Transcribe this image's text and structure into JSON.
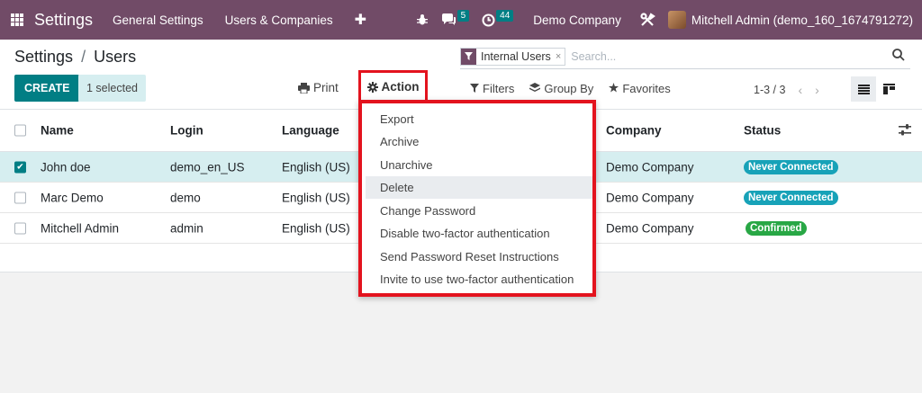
{
  "navbar": {
    "app_title": "Settings",
    "menu": [
      "General Settings",
      "Users & Companies"
    ],
    "plus": "✚",
    "messages_count": "5",
    "activities_count": "44",
    "company": "Demo Company",
    "user": "Mitchell Admin (demo_160_1674791272)",
    "color": "#714B67"
  },
  "breadcrumb": {
    "parent": "Settings",
    "separator": "/",
    "current": "Users"
  },
  "toolbar": {
    "create_label": "CREATE",
    "selected_label": "1 selected",
    "print_label": "Print",
    "action_label": "Action"
  },
  "search": {
    "facet_label": "Internal Users",
    "facet_remove": "×",
    "placeholder": "Search..."
  },
  "filters": {
    "filters_label": "Filters",
    "groupby_label": "Group By",
    "favorites_label": "Favorites"
  },
  "pager": {
    "value": "1-3 / 3",
    "prev": "‹",
    "next": "›"
  },
  "table": {
    "columns": [
      "Name",
      "Login",
      "Language",
      "Company",
      "Status"
    ],
    "rows": [
      {
        "name": "John doe",
        "login": "demo_en_US",
        "language": "English (US)",
        "company": "Demo Company",
        "status": "Never Connected",
        "selected": true
      },
      {
        "name": "Marc Demo",
        "login": "demo",
        "language": "English (US)",
        "company": "Demo Company",
        "status": "Never Connected",
        "selected": false
      },
      {
        "name": "Mitchell Admin",
        "login": "admin",
        "language": "English (US)",
        "company": "Demo Company",
        "status": "Confirmed",
        "selected": false
      }
    ]
  },
  "action_menu": {
    "items": [
      "Export",
      "Archive",
      "Unarchive",
      "Delete",
      "Change Password",
      "Disable two-factor authentication",
      "Send Password Reset Instructions",
      "Invite to use two-factor authentication"
    ]
  },
  "colors": {
    "primary": "#017e84",
    "highlight": "#e3131e",
    "status_info": "#17a2b8",
    "status_ok": "#28a745"
  }
}
